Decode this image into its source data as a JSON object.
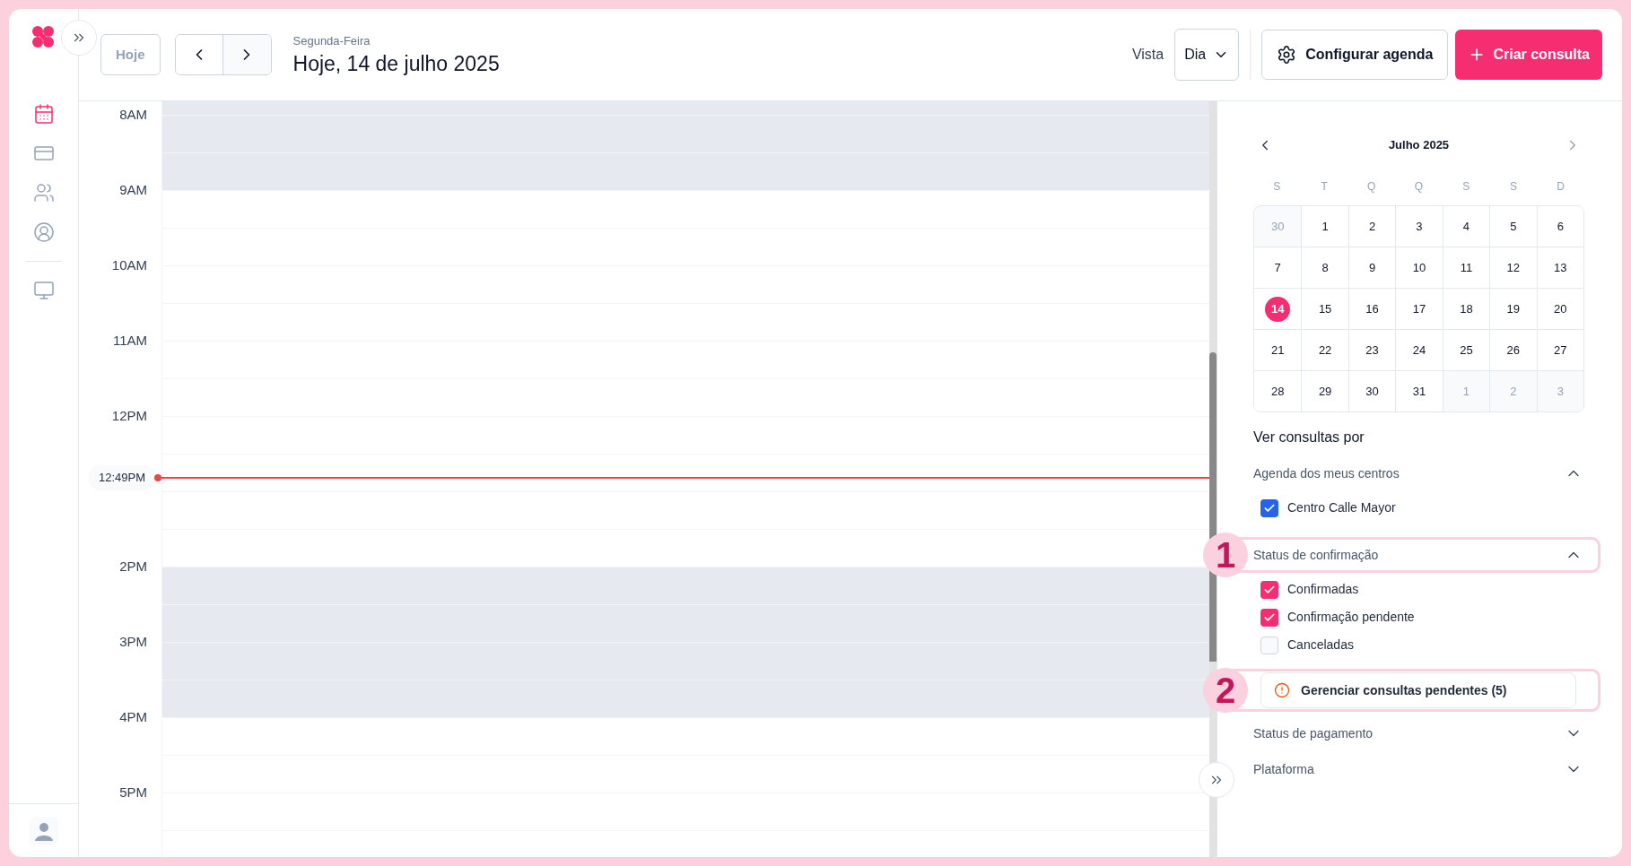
{
  "sidebar": {
    "items": [
      {
        "kind": "calendar",
        "selected": true
      },
      {
        "kind": "card",
        "selected": false
      },
      {
        "kind": "users",
        "selected": false
      },
      {
        "kind": "profile",
        "selected": false
      },
      {
        "kind": "monitor",
        "selected": false
      }
    ]
  },
  "header": {
    "today_button": {
      "label": "Hoje",
      "disabled": true
    },
    "weekday": "Segunda-Feira",
    "title": "Hoje, 14 de julho 2025",
    "view_label": "Vista",
    "view_select": "Dia",
    "config_button": "Configurar agenda",
    "create_button": "Criar consulta"
  },
  "schedule": {
    "now_label": "12:49PM",
    "hours": [
      {
        "label": "8AM",
        "available": false
      },
      {
        "label": "9AM",
        "available": true
      },
      {
        "label": "10AM",
        "available": true
      },
      {
        "label": "11AM",
        "available": true
      },
      {
        "label": "12PM",
        "available": true
      },
      {
        "available": true
      },
      {
        "label": "2PM",
        "available": false
      },
      {
        "label": "3PM",
        "available": false
      },
      {
        "label": "4PM",
        "available": true
      },
      {
        "label": "5PM",
        "available": true
      }
    ]
  },
  "calendar": {
    "month": "Julho 2025",
    "weekdays": [
      "S",
      "T",
      "Q",
      "Q",
      "S",
      "S",
      "D"
    ],
    "weeks": [
      [
        {
          "day": "30",
          "outside": true,
          "selected": false
        },
        {
          "day": "1",
          "outside": false,
          "selected": false
        },
        {
          "day": "2",
          "outside": false,
          "selected": false
        },
        {
          "day": "3",
          "outside": false,
          "selected": false
        },
        {
          "day": "4",
          "outside": false,
          "selected": false
        },
        {
          "day": "5",
          "outside": false,
          "selected": false
        },
        {
          "day": "6",
          "outside": false,
          "selected": false
        }
      ],
      [
        {
          "day": "7",
          "outside": false,
          "selected": false
        },
        {
          "day": "8",
          "outside": false,
          "selected": false
        },
        {
          "day": "9",
          "outside": false,
          "selected": false
        },
        {
          "day": "10",
          "outside": false,
          "selected": false
        },
        {
          "day": "11",
          "outside": false,
          "selected": false
        },
        {
          "day": "12",
          "outside": false,
          "selected": false
        },
        {
          "day": "13",
          "outside": false,
          "selected": false
        }
      ],
      [
        {
          "day": "14",
          "outside": false,
          "selected": true
        },
        {
          "day": "15",
          "outside": false,
          "selected": false
        },
        {
          "day": "16",
          "outside": false,
          "selected": false
        },
        {
          "day": "17",
          "outside": false,
          "selected": false
        },
        {
          "day": "18",
          "outside": false,
          "selected": false
        },
        {
          "day": "19",
          "outside": false,
          "selected": false
        },
        {
          "day": "20",
          "outside": false,
          "selected": false
        }
      ],
      [
        {
          "day": "21",
          "outside": false,
          "selected": false
        },
        {
          "day": "22",
          "outside": false,
          "selected": false
        },
        {
          "day": "23",
          "outside": false,
          "selected": false
        },
        {
          "day": "24",
          "outside": false,
          "selected": false
        },
        {
          "day": "25",
          "outside": false,
          "selected": false
        },
        {
          "day": "26",
          "outside": false,
          "selected": false
        },
        {
          "day": "27",
          "outside": false,
          "selected": false
        }
      ],
      [
        {
          "day": "28",
          "outside": false,
          "selected": false
        },
        {
          "day": "29",
          "outside": false,
          "selected": false
        },
        {
          "day": "30",
          "outside": false,
          "selected": false
        },
        {
          "day": "31",
          "outside": false,
          "selected": false
        },
        {
          "day": "1",
          "outside": true,
          "selected": false
        },
        {
          "day": "2",
          "outside": true,
          "selected": false
        },
        {
          "day": "3",
          "outside": true,
          "selected": false
        }
      ]
    ]
  },
  "filters": {
    "title": "Ver consultas por",
    "sections": [
      {
        "title": "Agenda dos meus centros",
        "expanded": true,
        "color": "#2563eb",
        "options": [
          {
            "label": "Centro Calle Mayor",
            "checked": true
          }
        ]
      },
      {
        "title": "Status de confirmação",
        "expanded": true,
        "annotation": "1",
        "color": "#f72d72",
        "options": [
          {
            "label": "Confirmadas",
            "checked": true
          },
          {
            "label": "Confirmação pendente",
            "checked": true
          },
          {
            "label": "Canceladas",
            "checked": false
          }
        ],
        "action": {
          "label": "Gerenciar consultas pendentes (5)",
          "annotation": "2"
        }
      },
      {
        "title": "Status de pagamento",
        "expanded": false
      },
      {
        "title": "Plataforma",
        "expanded": false
      }
    ]
  }
}
